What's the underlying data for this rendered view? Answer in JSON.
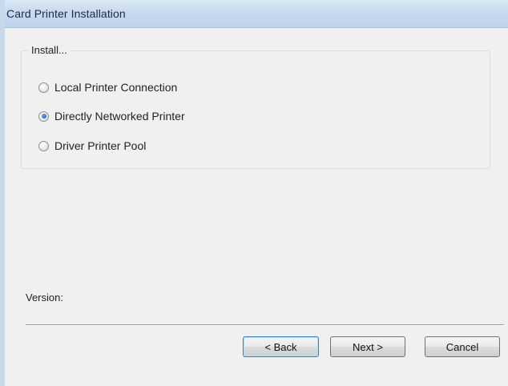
{
  "window": {
    "title": "Card Printer Installation"
  },
  "install_group": {
    "legend": "Install...",
    "options": [
      {
        "label": "Local Printer Connection",
        "checked": false
      },
      {
        "label": "Directly Networked Printer",
        "checked": true
      },
      {
        "label": "Driver Printer Pool",
        "checked": false
      }
    ]
  },
  "version": {
    "label": "Version:"
  },
  "buttons": {
    "back": "< Back",
    "next": "Next >",
    "cancel": "Cancel"
  }
}
